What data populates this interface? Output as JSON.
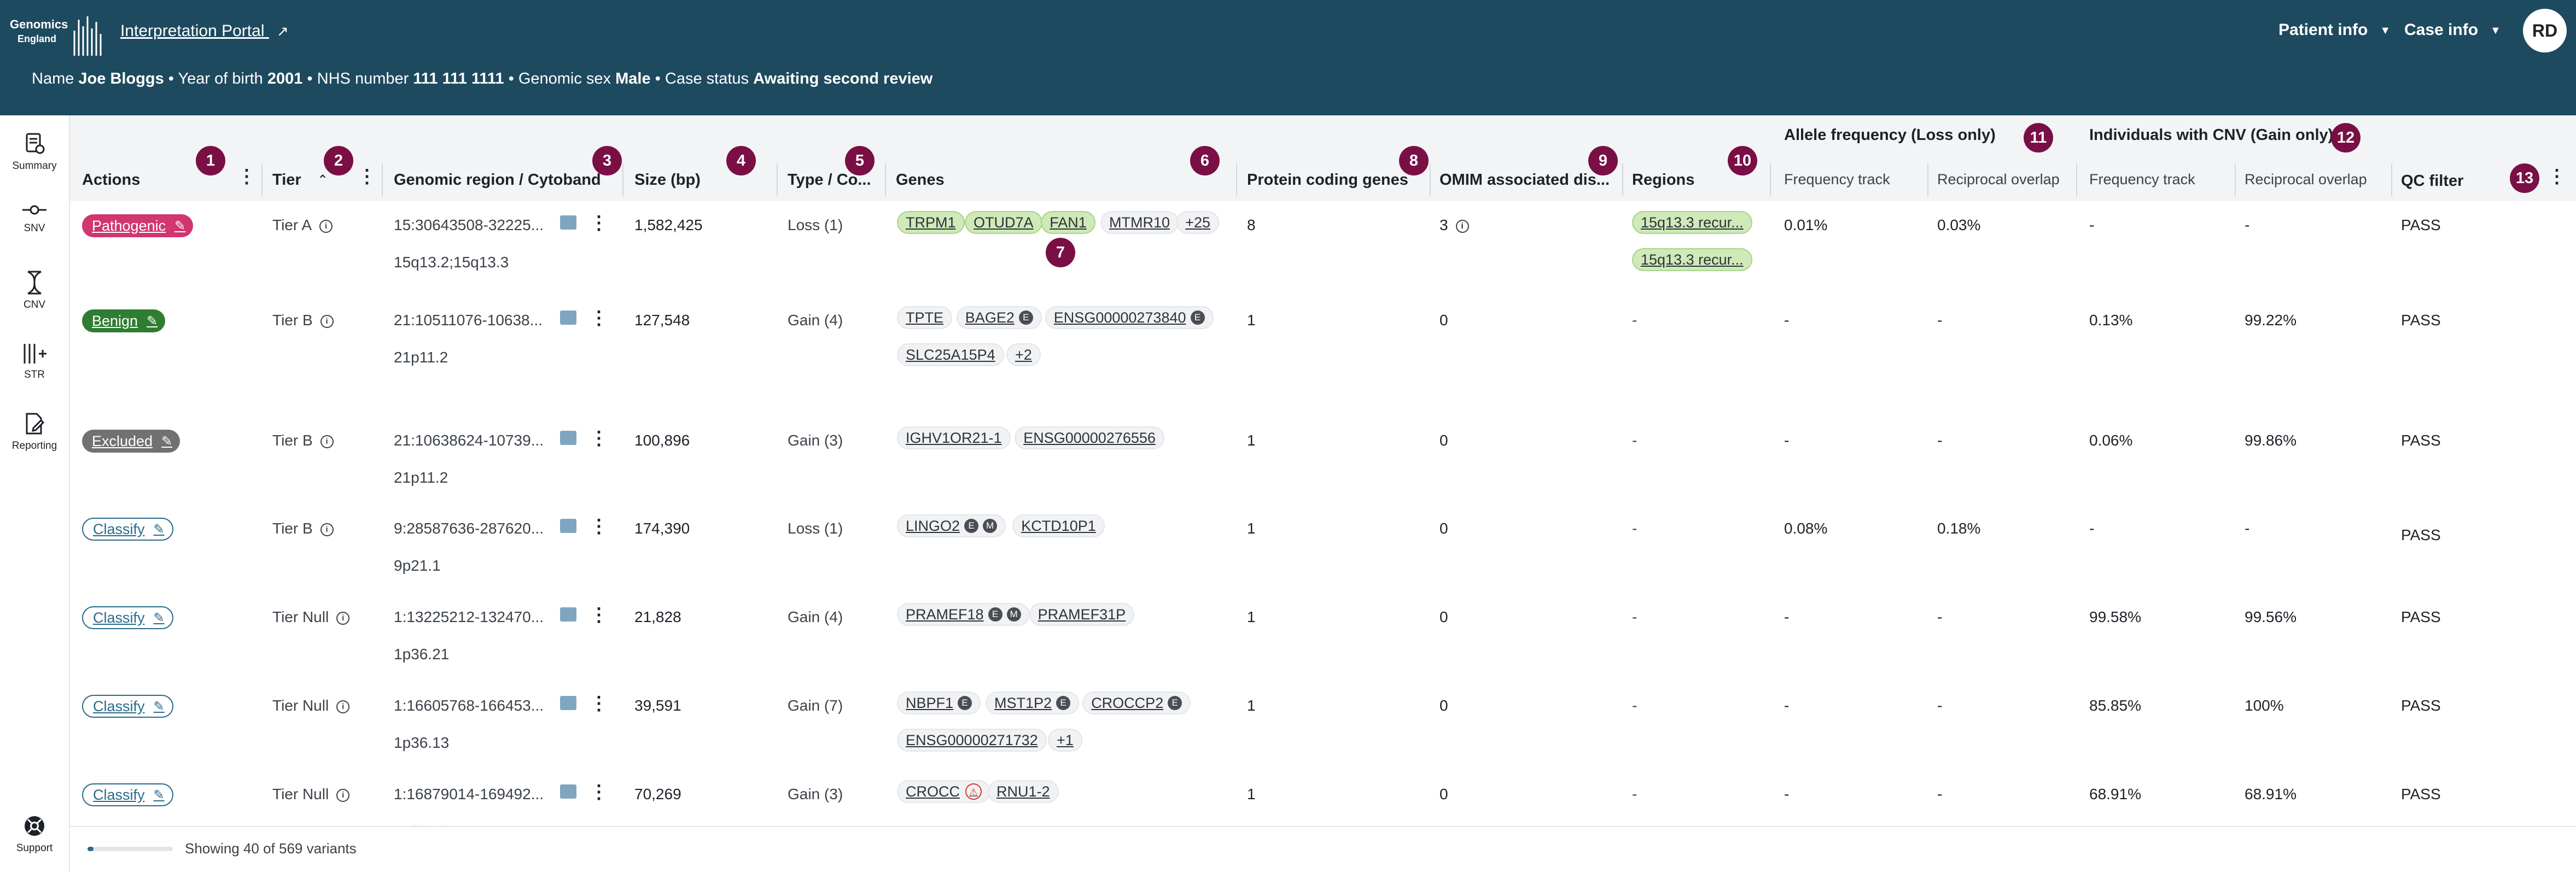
{
  "header": {
    "logo_text_line1": "Genomics",
    "logo_text_line2": "England",
    "portal_link": "Interpretation Portal",
    "patient_info": "Patient info",
    "case_info": "Case info",
    "avatar": "RD",
    "patient_line": {
      "name_label": "Name",
      "name": "Joe Bloggs",
      "yob_label": "Year of birth",
      "yob": "2001",
      "nhs_label": "NHS number",
      "nhs": "111 111 1111",
      "sex_label": "Genomic sex",
      "sex": "Male",
      "status_label": "Case status",
      "status": "Awaiting second review"
    }
  },
  "sidebar": {
    "items": [
      {
        "label": "Summary",
        "icon": "summary-icon"
      },
      {
        "label": "SNV",
        "icon": "snv-icon"
      },
      {
        "label": "CNV",
        "icon": "cnv-icon"
      },
      {
        "label": "STR",
        "icon": "str-icon"
      },
      {
        "label": "Reporting",
        "icon": "reporting-icon"
      },
      {
        "label": "Support",
        "icon": "support-icon"
      }
    ]
  },
  "table": {
    "columns": {
      "actions": "Actions",
      "tier": "Tier",
      "genomic_region": "Genomic region / Cytoband",
      "size": "Size (bp)",
      "type": "Type / Co...",
      "genes": "Genes",
      "protein_coding": "Protein coding genes",
      "omim": "OMIM associated dis...",
      "regions": "Regions",
      "allele_group": "Allele frequency (Loss only)",
      "cnv_group": "Individuals with CNV (Gain only)",
      "frequency_track": "Frequency track",
      "reciprocal_overlap": "Reciprocal overlap",
      "qc": "QC filter"
    },
    "badges": [
      "1",
      "2",
      "3",
      "4",
      "5",
      "6",
      "7",
      "8",
      "9",
      "10",
      "11",
      "12",
      "13"
    ],
    "rows": [
      {
        "classification": "Pathogenic",
        "cls": "pathogenic",
        "tier": "Tier A",
        "region": "15:30643508-32225...",
        "cytoband": "15q13.2;15q13.3",
        "size": "1,582,425",
        "type": "Loss (1)",
        "genes": [
          {
            "name": "TRPM1",
            "green": true
          },
          {
            "name": "OTUD7A",
            "green": true
          },
          {
            "name": "FAN1",
            "green": true
          },
          {
            "name": "MTMR10"
          },
          {
            "name": "+25"
          }
        ],
        "protein": "8",
        "omim": "3",
        "omim_info": true,
        "regions": [
          "15q13.3 recur...",
          "15q13.3 recur..."
        ],
        "af_freq": "0.01%",
        "af_overlap": "0.03%",
        "cnv_freq": "-",
        "cnv_overlap": "-",
        "qc": "PASS"
      },
      {
        "classification": "Benign",
        "cls": "benign",
        "tier": "Tier B",
        "region": "21:10511076-10638...",
        "cytoband": "21p11.2",
        "size": "127,548",
        "type": "Gain (4)",
        "genes": [
          {
            "name": "TPTE"
          },
          {
            "name": "BAGE2",
            "tags": [
              "E"
            ]
          },
          {
            "name": "ENSG00000273840",
            "tags": [
              "E"
            ]
          },
          {
            "name": "SLC25A15P4"
          },
          {
            "name": "+2"
          }
        ],
        "protein": "1",
        "omim": "0",
        "regions": [
          "-"
        ],
        "af_freq": "-",
        "af_overlap": "-",
        "cnv_freq": "0.13%",
        "cnv_overlap": "99.22%",
        "qc": "PASS"
      },
      {
        "classification": "Excluded",
        "cls": "excluded",
        "tier": "Tier B",
        "region": "21:10638624-10739...",
        "cytoband": "21p11.2",
        "size": "100,896",
        "type": "Gain (3)",
        "genes": [
          {
            "name": "IGHV1OR21-1"
          },
          {
            "name": "ENSG00000276556"
          }
        ],
        "protein": "1",
        "omim": "0",
        "regions": [
          "-"
        ],
        "af_freq": "-",
        "af_overlap": "-",
        "cnv_freq": "0.06%",
        "cnv_overlap": "99.86%",
        "qc": "PASS"
      },
      {
        "classification": "Classify",
        "cls": "classify",
        "tier": "Tier B",
        "region": "9:28587636-287620...",
        "cytoband": "9p21.1",
        "size": "174,390",
        "type": "Loss (1)",
        "genes": [
          {
            "name": "LINGO2",
            "tags": [
              "E",
              "M"
            ]
          },
          {
            "name": "KCTD10P1"
          }
        ],
        "protein": "1",
        "omim": "0",
        "regions": [
          "-"
        ],
        "af_freq": "0.08%",
        "af_overlap": "0.18%",
        "cnv_freq": "-",
        "cnv_overlap": "-",
        "qc": "PASS"
      },
      {
        "classification": "Classify",
        "cls": "classify",
        "tier": "Tier Null",
        "region": "1:13225212-132470...",
        "cytoband": "1p36.21",
        "size": "21,828",
        "type": "Gain (4)",
        "genes": [
          {
            "name": "PRAMEF18",
            "tags": [
              "E",
              "M"
            ]
          },
          {
            "name": "PRAMEF31P"
          }
        ],
        "protein": "1",
        "omim": "0",
        "regions": [
          "-"
        ],
        "af_freq": "-",
        "af_overlap": "-",
        "cnv_freq": "99.58%",
        "cnv_overlap": "99.56%",
        "qc": "PASS"
      },
      {
        "classification": "Classify",
        "cls": "classify",
        "tier": "Tier Null",
        "region": "1:16605768-166453...",
        "cytoband": "1p36.13",
        "size": "39,591",
        "type": "Gain (7)",
        "genes": [
          {
            "name": "NBPF1",
            "tags": [
              "E"
            ]
          },
          {
            "name": "MST1P2",
            "tags": [
              "E"
            ]
          },
          {
            "name": "CROCCP2",
            "tags": [
              "E"
            ]
          },
          {
            "name": "ENSG00000271732"
          },
          {
            "name": "+1"
          }
        ],
        "protein": "1",
        "omim": "0",
        "regions": [
          "-"
        ],
        "af_freq": "-",
        "af_overlap": "-",
        "cnv_freq": "85.85%",
        "cnv_overlap": "100%",
        "qc": "PASS"
      },
      {
        "classification": "Classify",
        "cls": "classify",
        "tier": "Tier Null",
        "region": "1:16879014-169492...",
        "cytoband": "1p36.13",
        "size": "70,269",
        "type": "Gain (3)",
        "genes": [
          {
            "name": "CROCC",
            "warn": true
          },
          {
            "name": "RNU1-2"
          }
        ],
        "protein": "1",
        "omim": "0",
        "regions": [
          "-"
        ],
        "af_freq": "-",
        "af_overlap": "-",
        "cnv_freq": "68.91%",
        "cnv_overlap": "68.91%",
        "qc": "PASS"
      }
    ]
  },
  "footer": {
    "status": "Showing 40 of 569 variants",
    "loaded_fraction": 0.07
  }
}
